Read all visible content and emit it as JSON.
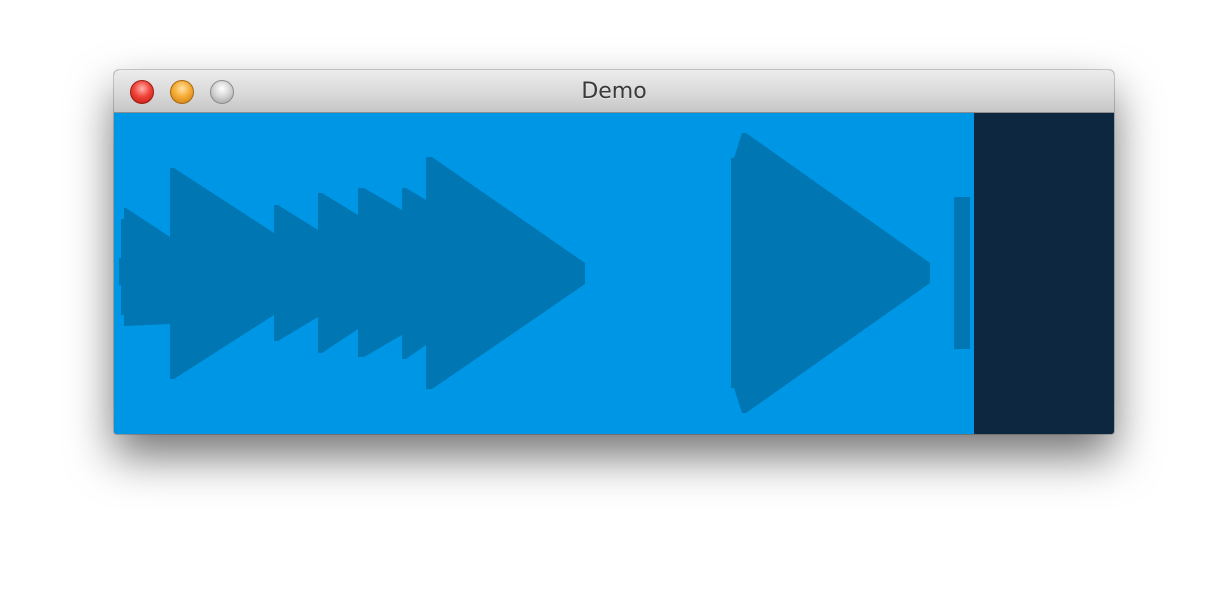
{
  "window": {
    "title": "Demo",
    "buttons": {
      "close": "close-button",
      "minimize": "minimize-button",
      "zoom": "zoom-button"
    }
  },
  "colors": {
    "panel_blue": "#0096e6",
    "shape_blue": "#0077b3",
    "right_panel": "#0d2740"
  },
  "icons": [
    "close-icon",
    "minimize-icon",
    "zoom-icon",
    "waveform-icon",
    "play-icon"
  ]
}
